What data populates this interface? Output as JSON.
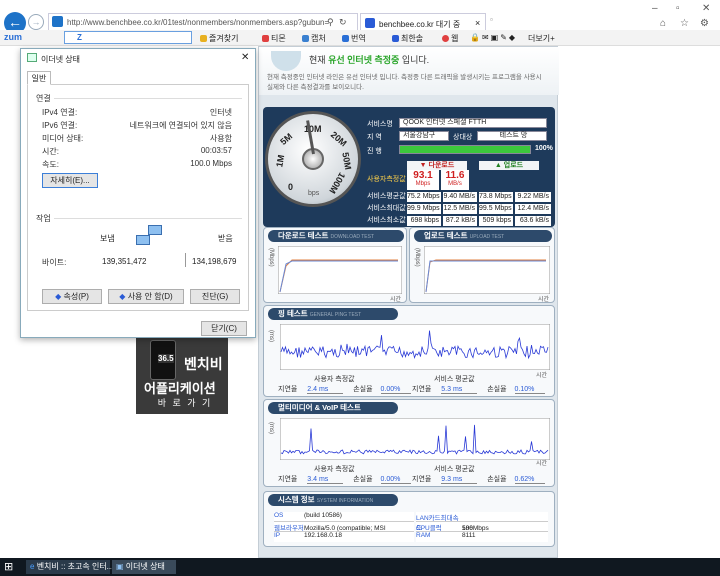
{
  "browser": {
    "url": "http://www.benchbee.co.kr/01test/nonmembers/nonmembers.asp?gubun=",
    "tab_title": "benchbee.co.kr 대기 중",
    "search_brand": "zum",
    "search_value": "Z",
    "toolbar_items": [
      "즐겨찾기",
      "티몬",
      "캡처",
      "번역",
      "최한솔",
      "웹",
      "더보기+"
    ]
  },
  "dialog": {
    "title": "이더넷 상태",
    "tab": "일반",
    "section_connection": "연결",
    "rows": [
      {
        "label": "IPv4 연결:",
        "value": "인터넷"
      },
      {
        "label": "IPv6 연결:",
        "value": "네트워크에 연결되어 있지 않음"
      },
      {
        "label": "미디어 상태:",
        "value": "사용함"
      },
      {
        "label": "시간:",
        "value": "00:03:57"
      },
      {
        "label": "속도:",
        "value": "100.0 Mbps"
      }
    ],
    "details_button": "자세히(E)...",
    "section_activity": "작업",
    "sent_label": "보냄",
    "received_label": "받음",
    "bytes_label": "바이트:",
    "bytes_sent": "139,351,472",
    "bytes_received": "134,198,679",
    "properties_button": "속성(P)",
    "disable_button": "사용 안 함(D)",
    "diagnose_button": "진단(G)",
    "close_button": "닫기(C)"
  },
  "banner": {
    "speed": "36.5",
    "line1": "벤치비",
    "line2": "어플리케이션",
    "line3": "바 로 가 기"
  },
  "page": {
    "heading_pre": "현재",
    "heading_highlight": "유선 인터넷 측정중",
    "heading_post": "입니다.",
    "desc1": "현재 측정중인 인터넷 라인은 유선 인터넷 입니다. 측정중 다른 트래픽을 발생시키는 프로그램을 사용시",
    "desc2": "실제와 다른 측정결과를 보이오니다.",
    "gauge_ticks": [
      "10M",
      "20M",
      "50M",
      "100M",
      "0",
      "1M",
      "5M"
    ],
    "gauge_unit": "bps",
    "provider_label": "서비스명",
    "provider_value": "QOOK 인터넷 스페셜 FTTH",
    "region_label": "지 역",
    "region_value": "서울강남구",
    "target_label": "상대상",
    "target_value": "테스트 망",
    "progress_label": "진 행",
    "progress_value": "100%",
    "progress_fraction": 1.0,
    "download_header": "다운로드",
    "upload_header": "업로드",
    "user_measured_label": "사용자측정값",
    "dl_mbps": "93.1",
    "dl_mbps_unit": "Mbps",
    "dl_MBs": "11.6",
    "dl_MBs_unit": "MB/s",
    "stats": [
      {
        "label": "서비스평균값",
        "dl1": "75.2 Mbps",
        "dl2": "9.40 MB/s",
        "ul1": "73.8 Mbps",
        "ul2": "9.22 MB/s"
      },
      {
        "label": "서비스최대값",
        "dl1": "99.9 Mbps",
        "dl2": "12.5 MB/s",
        "ul1": "99.5 Mbps",
        "ul2": "12.4 MB/s"
      },
      {
        "label": "서비스최소값",
        "dl1": "698 kbps",
        "dl2": "87.2 kB/s",
        "ul1": "509 kbps",
        "ul2": "63.6 kB/s"
      }
    ],
    "download_test": "다운로드 테스트",
    "download_test_en": "DOWNLOAD TEST",
    "upload_test": "업로드 테스트",
    "upload_test_en": "UPLOAD TEST",
    "axis_y": "(Mbps)",
    "axis_x": "시간",
    "ping_test": "핑 테스트",
    "ping_test_en": "GENERAL PING TEST",
    "ping_axis_y": "(ms)",
    "latency_label": "지연율",
    "loss_label": "손실율",
    "user_measure": "사용자 측정값",
    "service_avg": "서비스 평균값",
    "ping_user_latency": "2.4 ms",
    "ping_user_loss": "0.00%",
    "ping_service_latency": "5.3 ms",
    "ping_service_loss": "0.10%",
    "voip_test": "멀티미디어 & VoIP 테스트",
    "voip_user_latency": "3.4 ms",
    "voip_user_loss": "0.00%",
    "voip_service_latency": "9.3 ms",
    "voip_service_loss": "0.62%",
    "sysinfo": "시스템 정보",
    "sysinfo_en": "SYSTEM INFORMATION",
    "sys_left": [
      {
        "label": "OS",
        "value": "(build 10586)"
      },
      {
        "label": "웹브라우저",
        "value": "Mozilla/5.0 (compatible; MSI"
      },
      {
        "label": "IP",
        "value": "192.168.0.18"
      }
    ],
    "sys_right": [
      {
        "label": "LAN카드최대속도",
        "value": "100Mbps"
      },
      {
        "label": "CPU클럭",
        "value": "586"
      },
      {
        "label": "RAM",
        "value": "8111"
      }
    ]
  },
  "taskbar": {
    "item1": "벤치비 :: 초고속 인터...",
    "item2": "이더넷 상태"
  },
  "colors": {
    "accent": "#2d4a6b",
    "download": "#e03a2a",
    "upload": "#2aa52a",
    "graph": "#2a3ad6"
  }
}
